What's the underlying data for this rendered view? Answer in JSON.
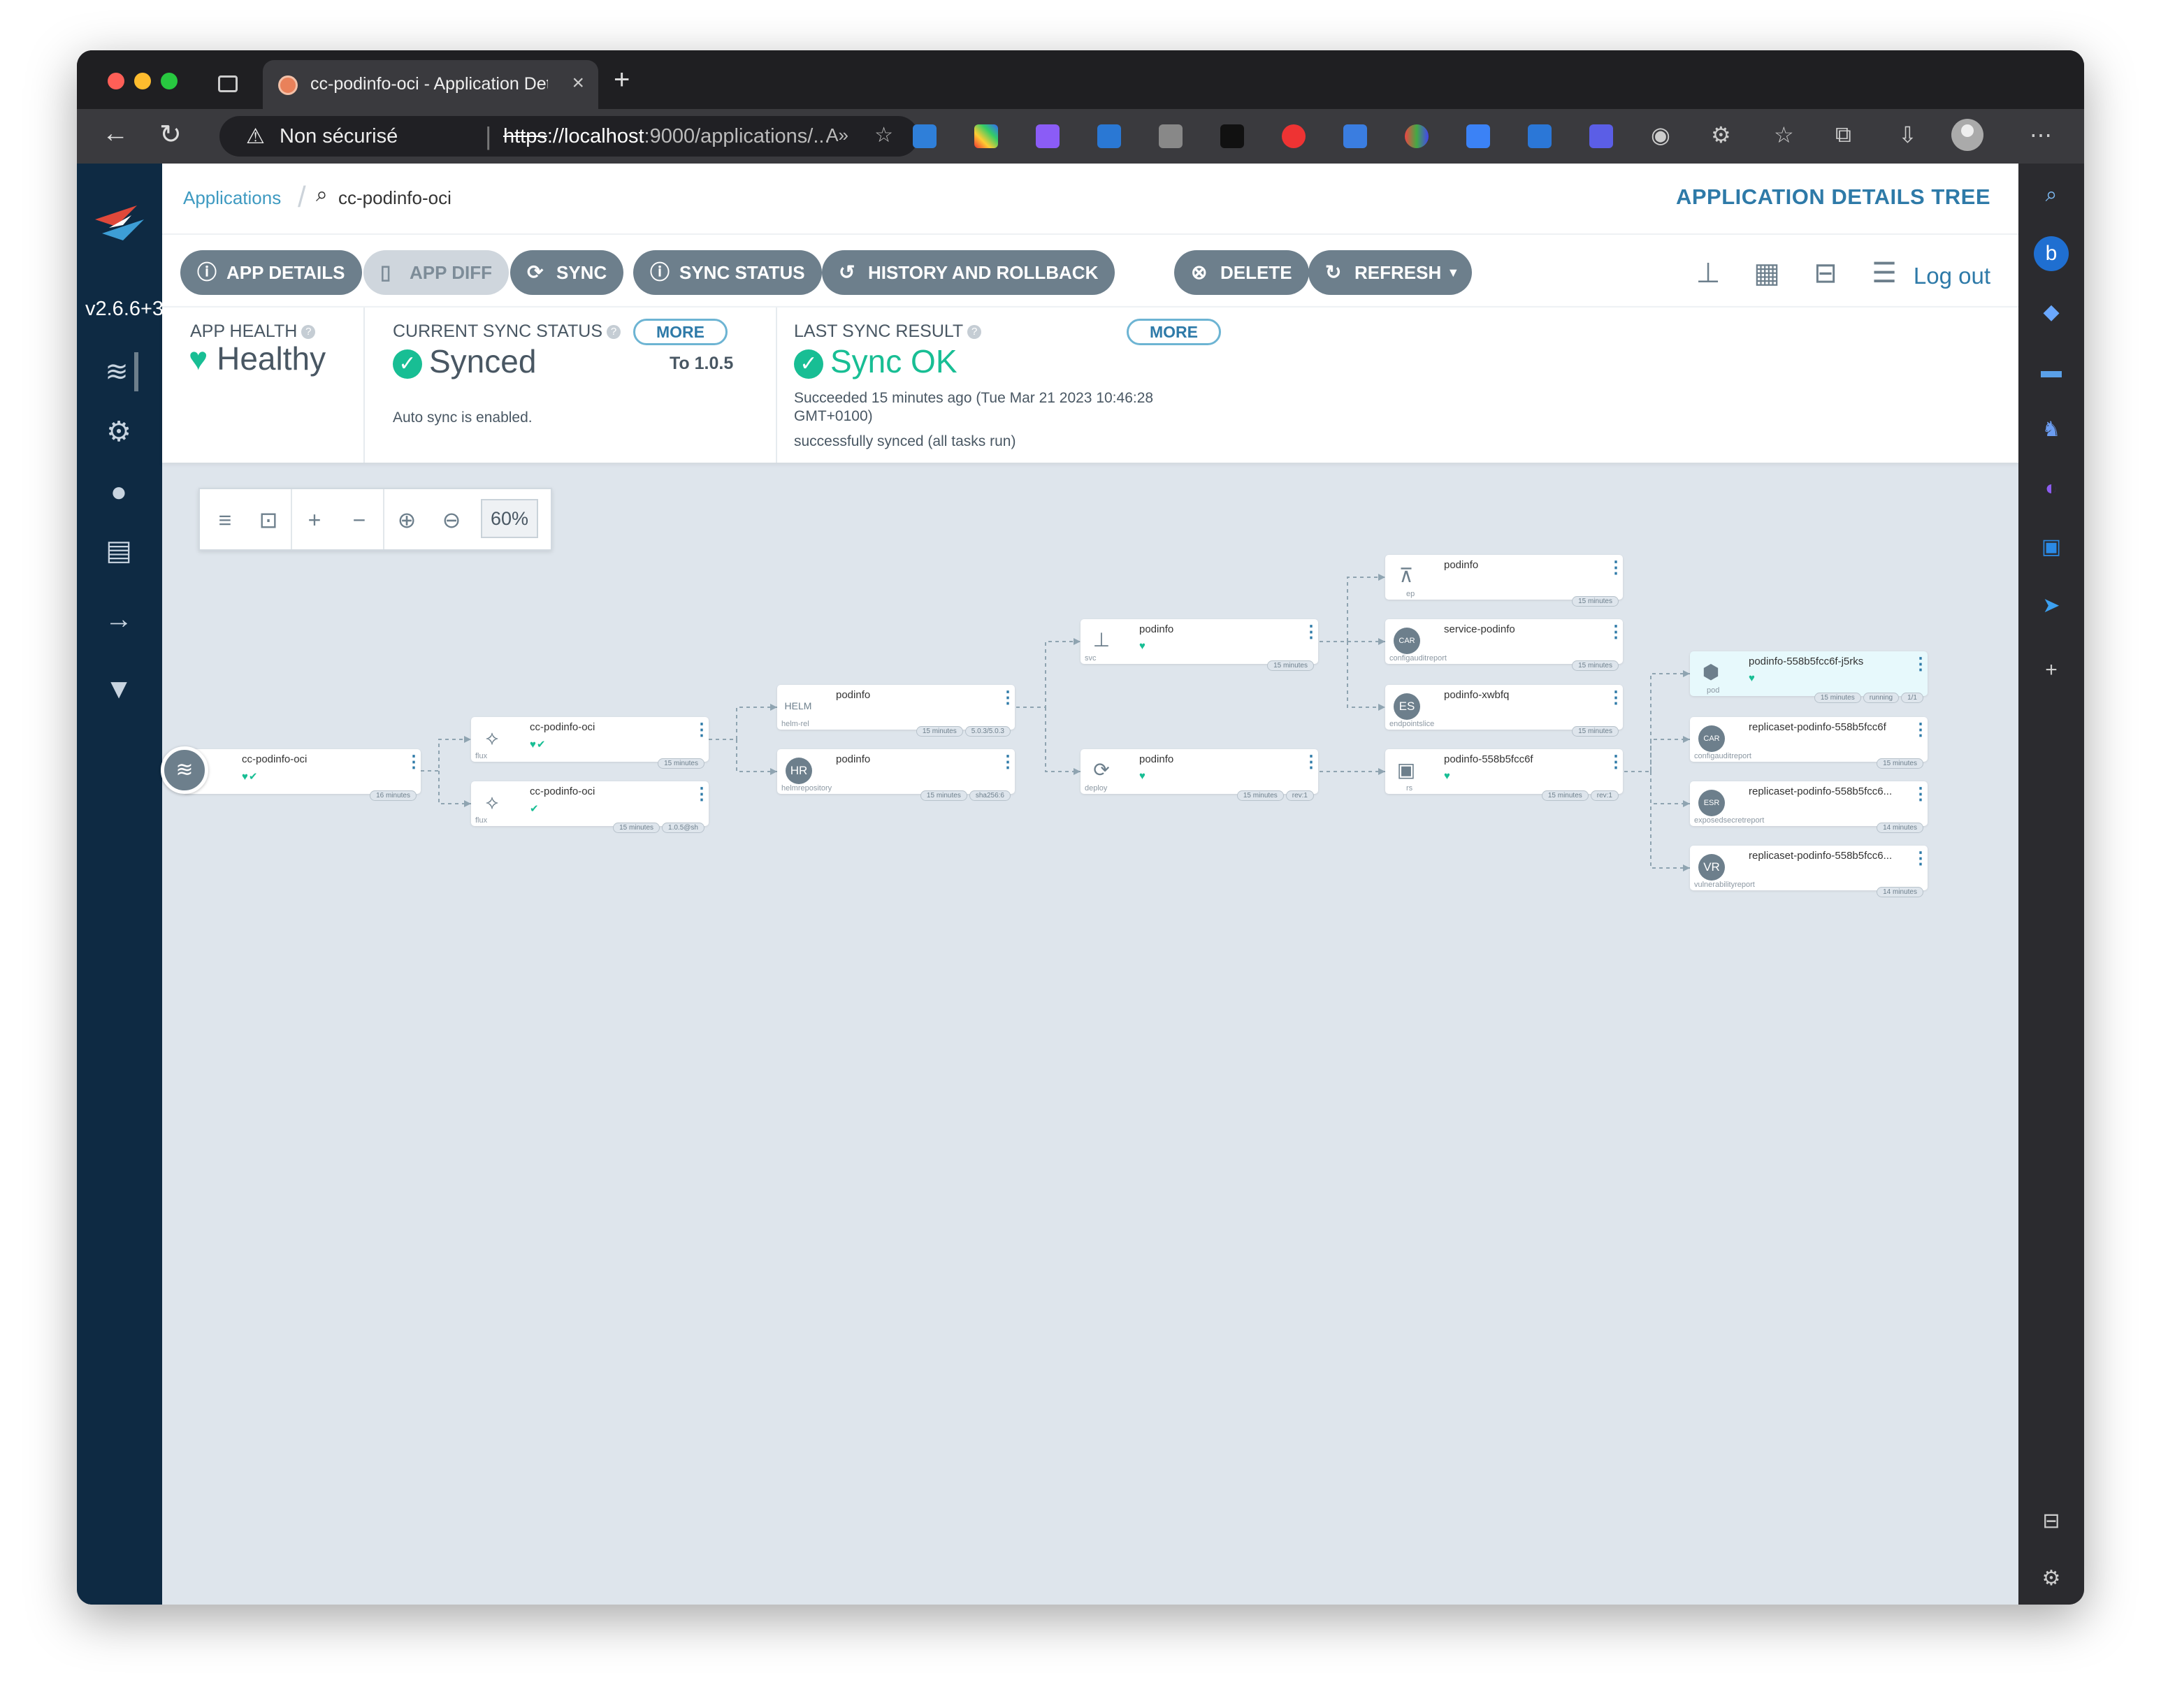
{
  "browser": {
    "tab_title": "cc-podinfo-oci - Application Details",
    "tab_close": "×",
    "new_tab": "+",
    "security_label": "Non sécurisé",
    "url_scheme": "https",
    "url_host": "://localhost",
    "url_rest": ":9000/applications/...",
    "more": "⋯"
  },
  "sidebar": {
    "version": "v2.6.6+3"
  },
  "breadcrumb": {
    "applications": "Applications",
    "app_name": "cc-podinfo-oci"
  },
  "header": {
    "title": "APPLICATION DETAILS TREE",
    "logout": "Log out"
  },
  "actions": {
    "app_details": "APP DETAILS",
    "app_diff": "APP DIFF",
    "sync": "SYNC",
    "sync_status": "SYNC STATUS",
    "history": "HISTORY AND ROLLBACK",
    "delete": "DELETE",
    "refresh": "REFRESH"
  },
  "status": {
    "app_health_label": "APP HEALTH",
    "app_health_value": "Healthy",
    "sync_status_label": "CURRENT SYNC STATUS",
    "sync_status_value": "Synced",
    "sync_more": "MORE",
    "sync_to": "To 1.0.5",
    "auto_sync": "Auto sync is enabled.",
    "last_sync_label": "LAST SYNC RESULT",
    "last_sync_value": "Sync OK",
    "last_sync_more": "MORE",
    "succeeded_line1": "Succeeded 15 minutes ago (Tue Mar 21 2023 10:46:28",
    "succeeded_line2": "GMT+0100)",
    "sync_message": "successfully synced (all tasks run)"
  },
  "zoom": {
    "level": "60%"
  },
  "nodes": {
    "root": {
      "name": "cc-podinfo-oci",
      "status": "♥✔",
      "tags": [
        "16 minutes"
      ]
    },
    "flux1": {
      "name": "cc-podinfo-oci",
      "kind": "flux",
      "status": "♥✔",
      "tags": [
        "15 minutes"
      ]
    },
    "flux2": {
      "name": "cc-podinfo-oci",
      "kind": "flux",
      "status": "✔",
      "tags": [
        "15 minutes",
        "1.0.5@sh"
      ]
    },
    "helmrel": {
      "name": "podinfo",
      "kind": "helm-rel",
      "tags": [
        "15 minutes",
        "5.0.3/5.0.3"
      ]
    },
    "helmrepo": {
      "name": "podinfo",
      "kind": "helmrepository",
      "icon": "HR",
      "tags": [
        "15 minutes",
        "sha256:6"
      ]
    },
    "svc": {
      "name": "podinfo",
      "kind": "svc",
      "status": "♥",
      "tags": [
        "15 minutes"
      ]
    },
    "deploy": {
      "name": "podinfo",
      "kind": "deploy",
      "status": "♥",
      "tags": [
        "15 minutes",
        "rev:1"
      ]
    },
    "ep": {
      "name": "podinfo",
      "kind": "ep",
      "tags": [
        "15 minutes"
      ]
    },
    "car": {
      "name": "service-podinfo",
      "kind": "configauditreport",
      "icon": "CAR",
      "tags": [
        "15 minutes"
      ]
    },
    "es": {
      "name": "podinfo-xwbfq",
      "kind": "endpointslice",
      "icon": "ES",
      "tags": [
        "15 minutes"
      ]
    },
    "rs": {
      "name": "podinfo-558b5fcc6f",
      "kind": "rs",
      "status": "♥",
      "tags": [
        "15 minutes",
        "rev:1"
      ]
    },
    "pod": {
      "name": "podinfo-558b5fcc6f-j5rks",
      "kind": "pod",
      "status": "♥",
      "tags": [
        "15 minutes",
        "running",
        "1/1"
      ]
    },
    "rscar": {
      "name": "replicaset-podinfo-558b5fcc6f",
      "kind": "configauditreport",
      "icon": "CAR",
      "tags": [
        "15 minutes"
      ]
    },
    "esr": {
      "name": "replicaset-podinfo-558b5fcc6...",
      "kind": "exposedsecretreport",
      "icon": "ESR",
      "tags": [
        "14 minutes"
      ]
    },
    "vr": {
      "name": "replicaset-podinfo-558b5fcc6...",
      "kind": "vulnerabilityreport",
      "icon": "VR",
      "tags": [
        "14 minutes"
      ]
    }
  }
}
